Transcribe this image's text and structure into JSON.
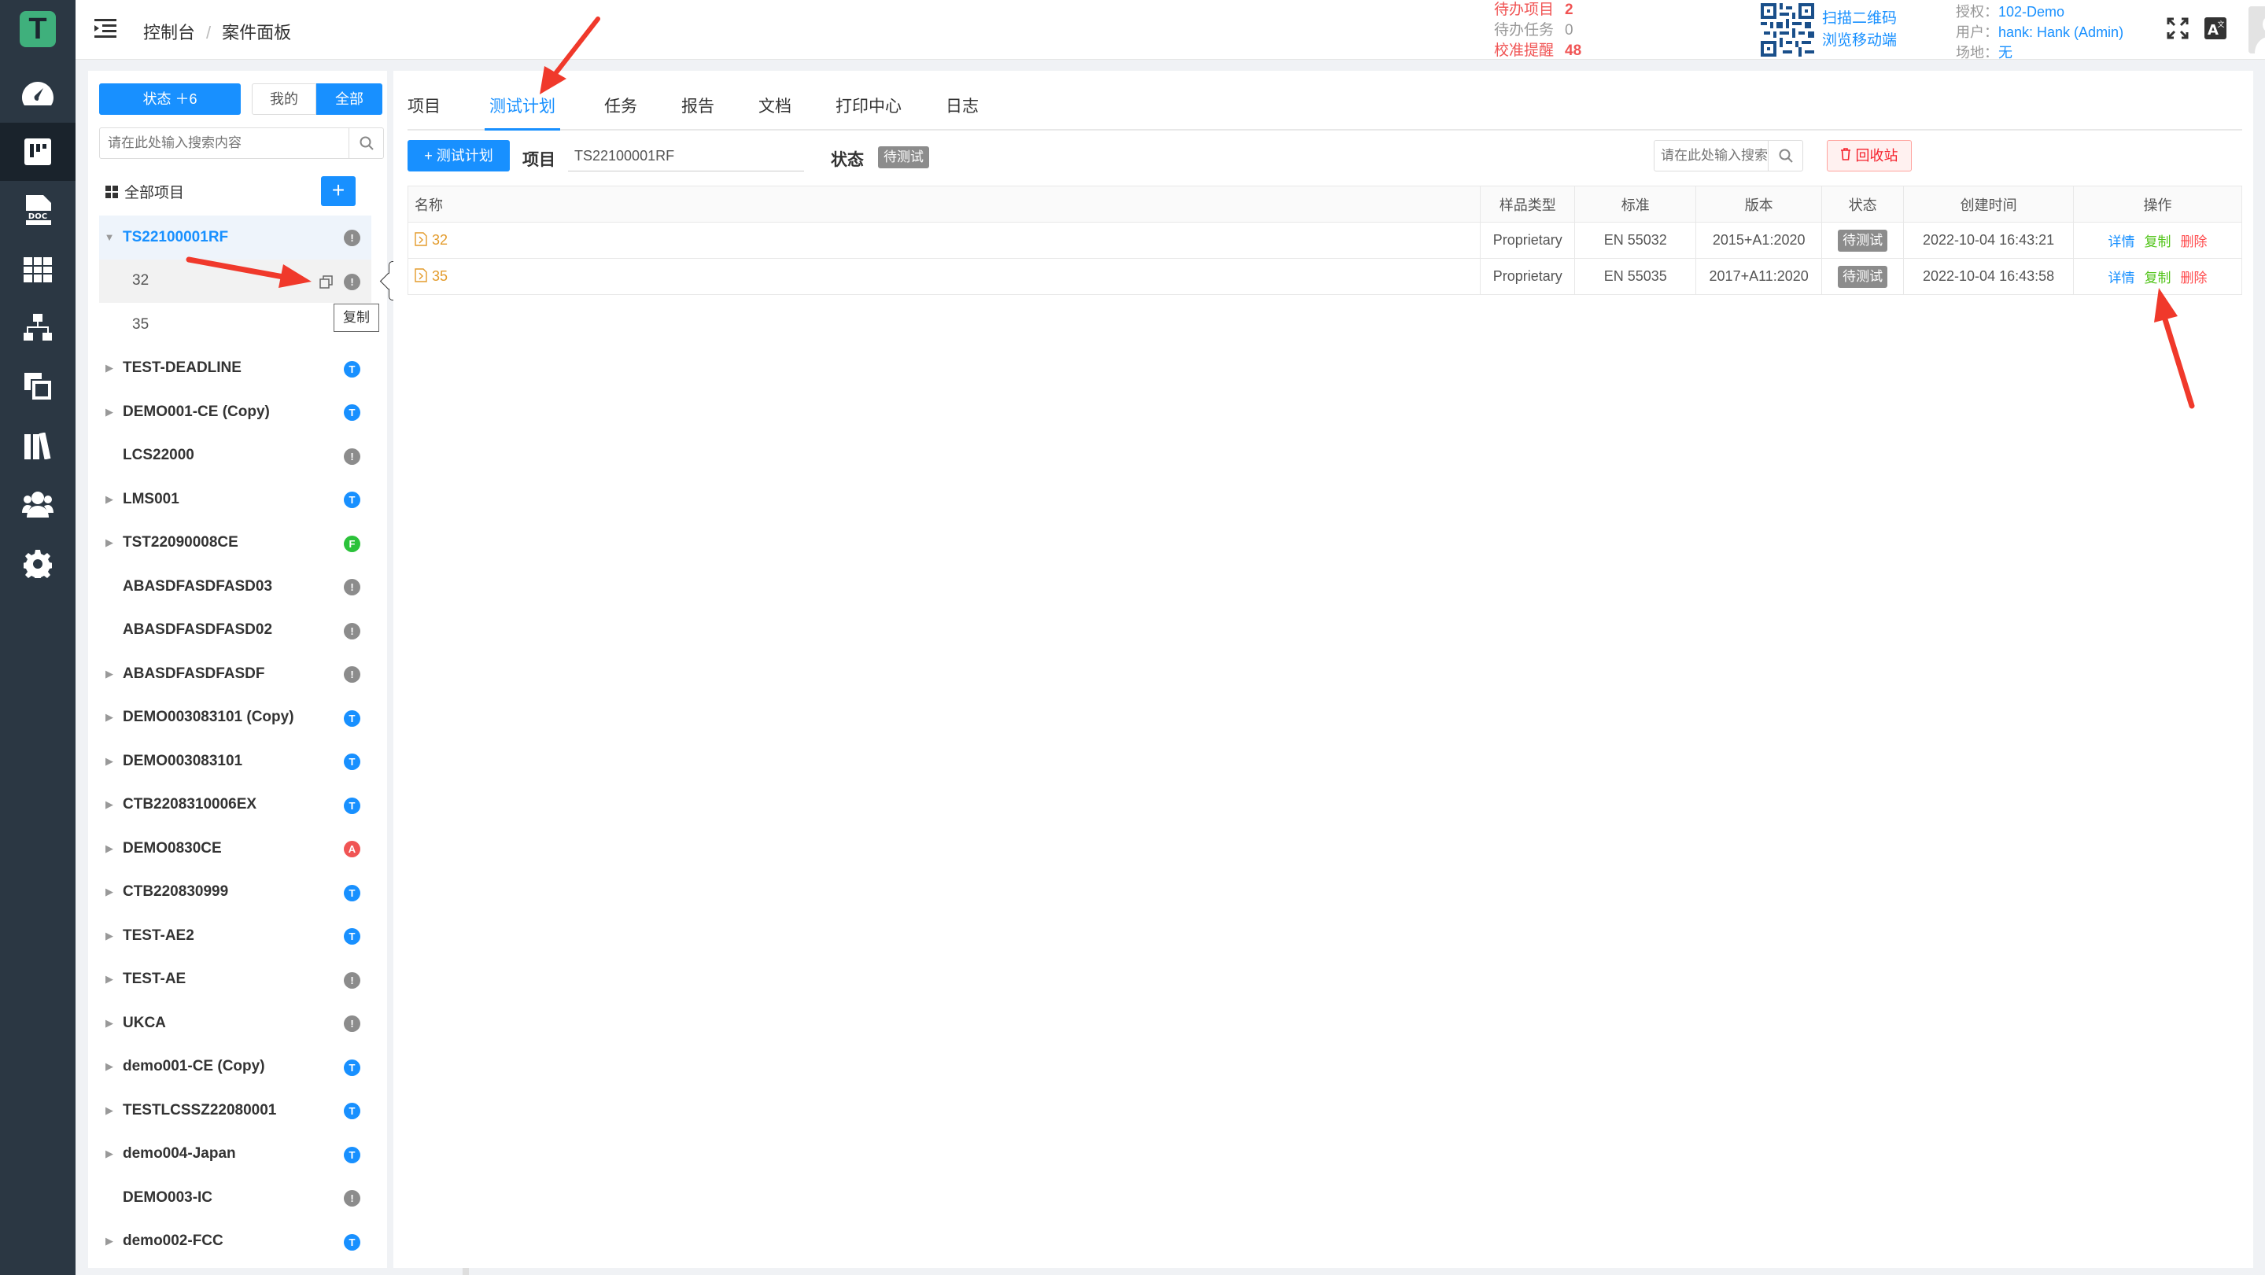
{
  "app": {
    "logo_letter": "T"
  },
  "rail": {
    "items": [
      {
        "icon": "dashboard-icon"
      },
      {
        "icon": "board-icon",
        "active": true
      },
      {
        "icon": "doc-icon"
      },
      {
        "icon": "grid-icon"
      },
      {
        "icon": "org-chart-icon"
      },
      {
        "icon": "copy-pages-icon"
      },
      {
        "icon": "books-icon"
      },
      {
        "icon": "users-icon"
      },
      {
        "icon": "gear-icon"
      }
    ]
  },
  "header": {
    "breadcrumb": [
      "控制台",
      "案件面板"
    ],
    "todo": [
      {
        "label": "待办项目",
        "value": "2",
        "color": "red"
      },
      {
        "label": "待办任务",
        "value": "0",
        "color": "gray"
      },
      {
        "label": "校准提醒",
        "value": "48",
        "color": "red"
      }
    ],
    "qr_text": [
      "扫描二维码",
      "浏览移动端"
    ],
    "account": {
      "auth_label": "授权：",
      "auth_value": "102-Demo",
      "user_label": "用户：",
      "user_value": "hank: Hank (Admin)",
      "site_label": "场地：",
      "site_value": "无"
    }
  },
  "sidebar": {
    "status_button": "状态 ＋6",
    "mine_button": "我的",
    "all_button": "全部",
    "search_placeholder": "请在此处输入搜索内容",
    "all_projects_label": "全部项目",
    "add_label": "+",
    "tree": [
      {
        "name": "TS22100001RF",
        "expanded": true,
        "selected": true,
        "badge": "!",
        "badge_color": "#8c8c8c"
      },
      {
        "name": "32",
        "child": true,
        "selected": true,
        "badge": "!",
        "badge_color": "#8c8c8c"
      },
      {
        "name": "35",
        "child": true,
        "badge": "",
        "badge_color": ""
      },
      {
        "name": "TEST-DEADLINE",
        "badge": "T",
        "badge_color": "#1890ff"
      },
      {
        "name": "DEMO001-CE (Copy)",
        "badge": "T",
        "badge_color": "#1890ff"
      },
      {
        "name": "LCS22000",
        "leaf": true,
        "badge": "!",
        "badge_color": "#8c8c8c"
      },
      {
        "name": "LMS001",
        "badge": "T",
        "badge_color": "#1890ff"
      },
      {
        "name": "TST22090008CE",
        "badge": "F",
        "badge_color": "#2bc23a"
      },
      {
        "name": "ABASDFASDFASD03",
        "leaf": true,
        "badge": "!",
        "badge_color": "#8c8c8c"
      },
      {
        "name": "ABASDFASDFASD02",
        "leaf": true,
        "badge": "!",
        "badge_color": "#8c8c8c"
      },
      {
        "name": "ABASDFASDFASDF",
        "badge": "!",
        "badge_color": "#8c8c8c"
      },
      {
        "name": "DEMO003083101 (Copy)",
        "badge": "T",
        "badge_color": "#1890ff"
      },
      {
        "name": "DEMO003083101",
        "badge": "T",
        "badge_color": "#1890ff"
      },
      {
        "name": "CTB2208310006EX",
        "badge": "T",
        "badge_color": "#1890ff"
      },
      {
        "name": "DEMO0830CE",
        "badge": "A",
        "badge_color": "#f05454"
      },
      {
        "name": "CTB220830999",
        "badge": "T",
        "badge_color": "#1890ff"
      },
      {
        "name": "TEST-AE2",
        "badge": "T",
        "badge_color": "#1890ff"
      },
      {
        "name": "TEST-AE",
        "badge": "!",
        "badge_color": "#8c8c8c"
      },
      {
        "name": "UKCA",
        "badge": "!",
        "badge_color": "#8c8c8c"
      },
      {
        "name": "demo001-CE (Copy)",
        "badge": "T",
        "badge_color": "#1890ff"
      },
      {
        "name": "TESTLCSSZ22080001",
        "badge": "T",
        "badge_color": "#1890ff"
      },
      {
        "name": "demo004-Japan",
        "badge": "T",
        "badge_color": "#1890ff"
      },
      {
        "name": "DEMO003-IC",
        "leaf": true,
        "badge": "!",
        "badge_color": "#8c8c8c"
      },
      {
        "name": "demo002-FCC",
        "badge": "T",
        "badge_color": "#1890ff"
      }
    ],
    "tooltip_value": "32",
    "tooltip_copy": "复制"
  },
  "main": {
    "tabs": [
      {
        "label": "项目"
      },
      {
        "label": "测试计划",
        "active": true
      },
      {
        "label": "任务"
      },
      {
        "label": "报告"
      },
      {
        "label": "文档"
      },
      {
        "label": "打印中心"
      },
      {
        "label": "日志"
      }
    ],
    "toolbar": {
      "add_plan": "+ 测试计划",
      "project_label": "项目",
      "project_value": "TS22100001RF",
      "status_label": "状态",
      "status_value": "待测试",
      "search_placeholder": "请在此处输入搜索内容",
      "recycle": "回收站"
    },
    "table": {
      "columns": [
        "名称",
        "样品类型",
        "标准",
        "版本",
        "状态",
        "创建时间",
        "操作"
      ],
      "rows": [
        {
          "name": "32",
          "sample_type": "Proprietary",
          "standard": "EN 55032",
          "version": "2015+A1:2020",
          "status": "待测试",
          "created": "2022-10-04 16:43:21"
        },
        {
          "name": "35",
          "sample_type": "Proprietary",
          "standard": "EN 55035",
          "version": "2017+A11:2020",
          "status": "待测试",
          "created": "2022-10-04 16:43:58"
        }
      ],
      "actions": {
        "detail": "详情",
        "copy": "复制",
        "delete": "删除"
      }
    }
  }
}
